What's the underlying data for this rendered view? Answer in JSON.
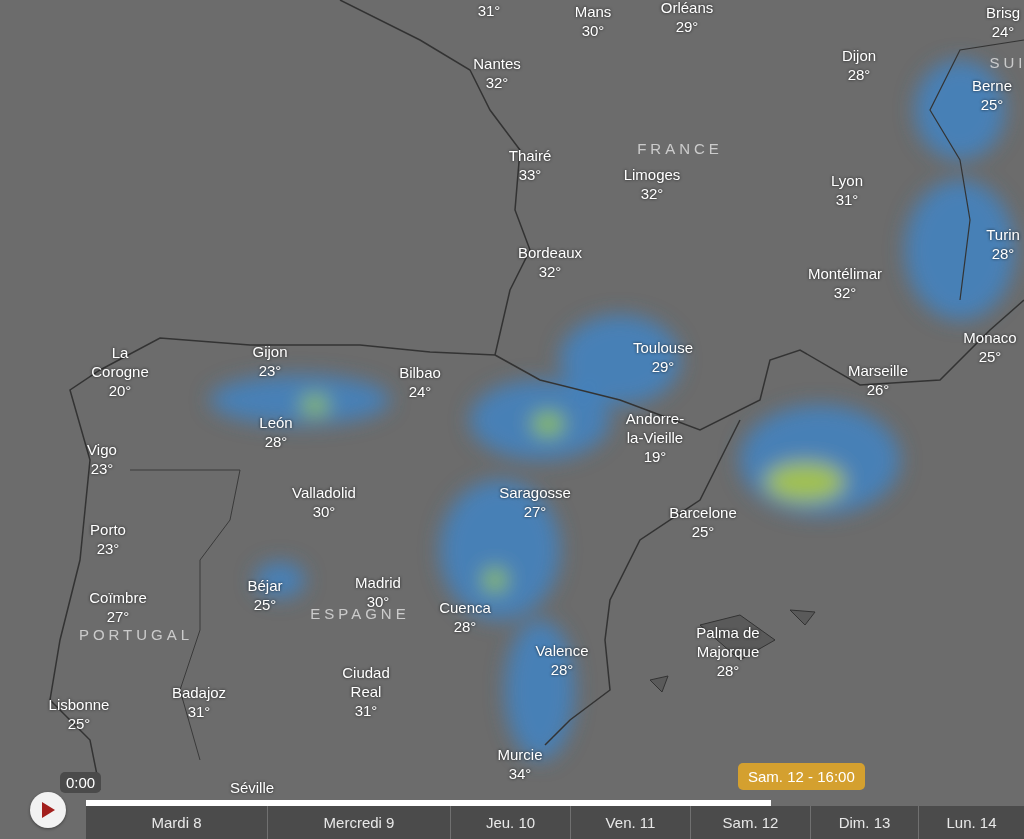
{
  "map": {
    "labels": [
      {
        "kind": "city",
        "temp": "31°"
      },
      {
        "kind": "city",
        "name": "Mans",
        "temp": "30°"
      },
      {
        "kind": "city",
        "name": "Orléans",
        "temp": "29°"
      },
      {
        "kind": "city",
        "name": "Brisg",
        "temp": "24°"
      },
      {
        "kind": "city",
        "name": "Nantes",
        "temp": "32°"
      },
      {
        "kind": "city",
        "name": "Dijon",
        "temp": "28°"
      },
      {
        "kind": "country",
        "name": "SUI"
      },
      {
        "kind": "city",
        "name": "Berne",
        "temp": "25°"
      },
      {
        "kind": "city",
        "name": "Thairé",
        "temp": "33°"
      },
      {
        "kind": "country",
        "name": "FRANCE"
      },
      {
        "kind": "city",
        "name": "Limoges",
        "temp": "32°"
      },
      {
        "kind": "city",
        "name": "Lyon",
        "temp": "31°"
      },
      {
        "kind": "city",
        "name": "Bordeaux",
        "temp": "32°"
      },
      {
        "kind": "city",
        "name": "Montélimar",
        "temp": "32°"
      },
      {
        "kind": "city",
        "name": "Turin",
        "temp": "28°"
      },
      {
        "kind": "city",
        "name": "La Corogne",
        "temp": "20°"
      },
      {
        "kind": "city",
        "name": "Gijon",
        "temp": "23°"
      },
      {
        "kind": "city",
        "name": "Bilbao",
        "temp": "24°"
      },
      {
        "kind": "city",
        "name": "Toulouse",
        "temp": "29°"
      },
      {
        "kind": "city",
        "name": "Marseille",
        "temp": "26°"
      },
      {
        "kind": "city",
        "name": "Monaco",
        "temp": "25°"
      },
      {
        "kind": "city",
        "name": "Vigo",
        "temp": "23°"
      },
      {
        "kind": "city",
        "name": "León",
        "temp": "28°"
      },
      {
        "kind": "city",
        "name": "Andorre-la-Vieille",
        "temp": "19°"
      },
      {
        "kind": "city",
        "name": "Valladolid",
        "temp": "30°"
      },
      {
        "kind": "city",
        "name": "Saragosse",
        "temp": "27°"
      },
      {
        "kind": "city",
        "name": "Barcelone",
        "temp": "25°"
      },
      {
        "kind": "city",
        "name": "Porto",
        "temp": "23°"
      },
      {
        "kind": "city",
        "name": "Coïmbre",
        "temp": "27°"
      },
      {
        "kind": "city",
        "name": "Béjar",
        "temp": "25°"
      },
      {
        "kind": "city",
        "name": "Madrid",
        "temp": "30°"
      },
      {
        "kind": "country",
        "name": "ESPAGNE"
      },
      {
        "kind": "country",
        "name": "PORTUGAL"
      },
      {
        "kind": "city",
        "name": "Cuenca",
        "temp": "28°"
      },
      {
        "kind": "city",
        "name": "Palma de Majorque",
        "temp": "28°"
      },
      {
        "kind": "city",
        "name": "Lisbonne",
        "temp": "25°"
      },
      {
        "kind": "city",
        "name": "Badajoz",
        "temp": "31°"
      },
      {
        "kind": "city",
        "name": "Ciudad Real",
        "temp": "31°"
      },
      {
        "kind": "city",
        "name": "Valence",
        "temp": "28°"
      },
      {
        "kind": "city",
        "name": "Murcie",
        "temp": "34°"
      },
      {
        "kind": "city",
        "name": "Séville"
      }
    ]
  },
  "timeline": {
    "time": "0:00",
    "tooltip": "Sam. 12 - 16:00",
    "level": 0.73,
    "days": [
      "Mardi 8",
      "Mercredi 9",
      "Jeu. 10",
      "Ven. 11",
      "Sam. 12",
      "Dim. 13",
      "Lun. 14"
    ]
  }
}
